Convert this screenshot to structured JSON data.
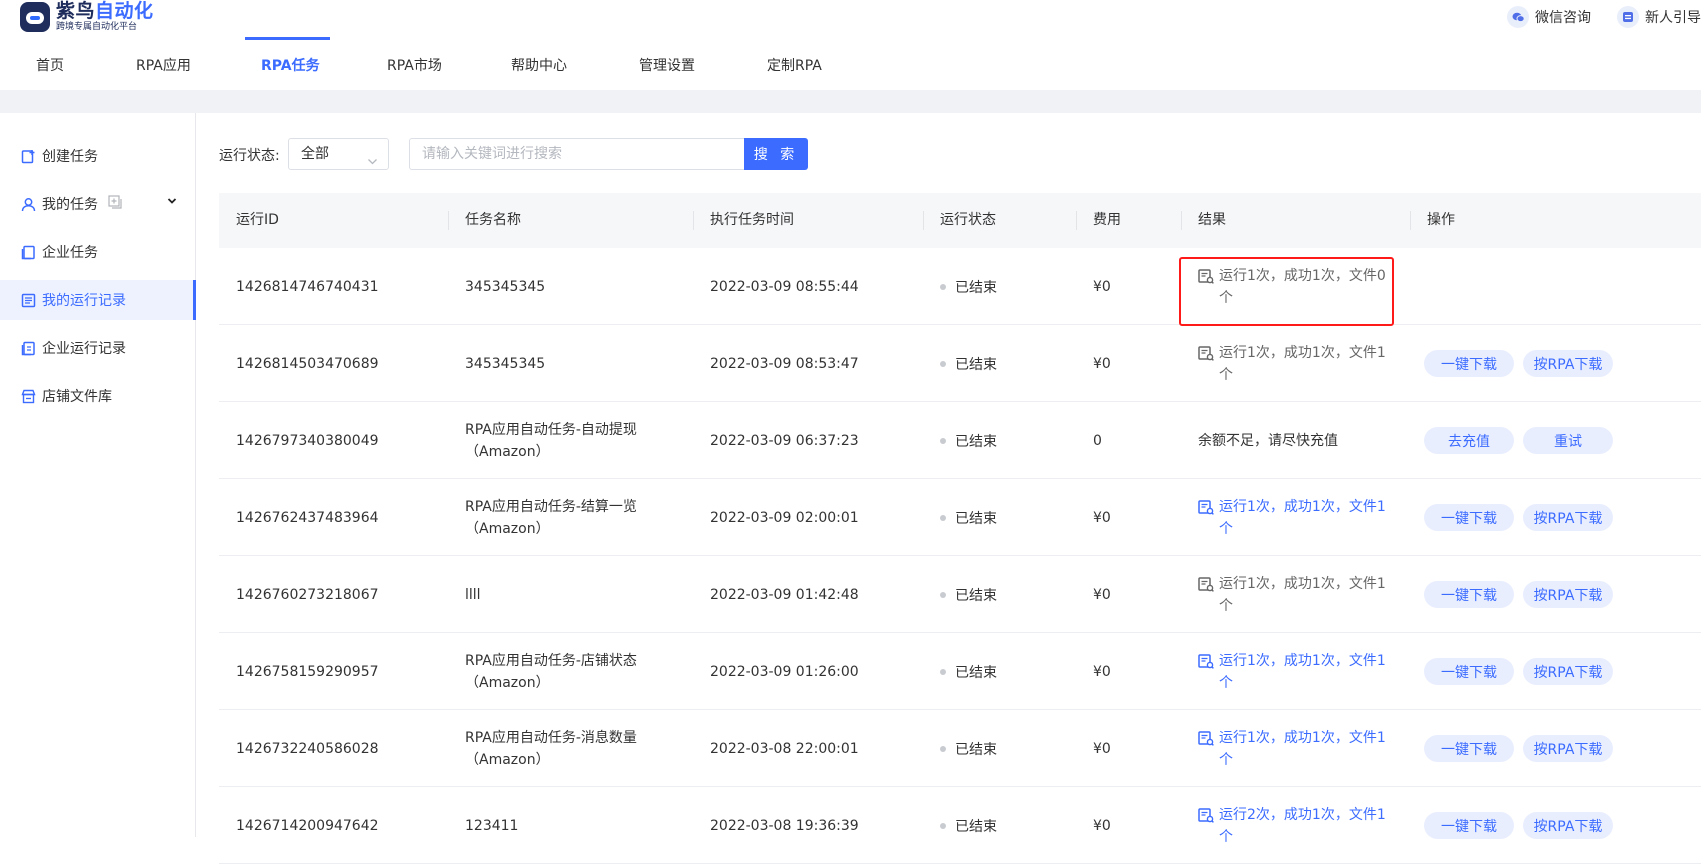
{
  "header": {
    "logo_title_main": "紫鸟",
    "logo_title_accent": "自动化",
    "logo_subtitle": "跨境专属自动化平台",
    "wechat_label": "微信咨询",
    "guide_label": "新人引导"
  },
  "nav": {
    "items": [
      {
        "label": "首页"
      },
      {
        "label": "RPA应用"
      },
      {
        "label": "RPA任务"
      },
      {
        "label": "RPA市场"
      },
      {
        "label": "帮助中心"
      },
      {
        "label": "管理设置"
      },
      {
        "label": "定制RPA"
      }
    ],
    "active": "RPA任务"
  },
  "sidebar": {
    "items": [
      {
        "label": "创建任务",
        "icon": "create-task-icon"
      },
      {
        "label": "我的任务",
        "icon": "user-icon"
      },
      {
        "label": "企业任务",
        "icon": "book-icon"
      },
      {
        "label": "我的运行记录",
        "icon": "list-icon"
      },
      {
        "label": "企业运行记录",
        "icon": "book-icon"
      },
      {
        "label": "店铺文件库",
        "icon": "store-icon"
      }
    ],
    "active": "我的运行记录"
  },
  "filters": {
    "status_label": "运行状态:",
    "status_value": "全部",
    "search_placeholder": "请输入关键词进行搜索",
    "search_button": "搜 索"
  },
  "table": {
    "columns": [
      "运行ID",
      "任务名称",
      "执行任务时间",
      "运行状态",
      "费用",
      "结果",
      "操作"
    ],
    "rows": [
      {
        "id": "1426814746740431",
        "name_1": "345345345",
        "name_2": "",
        "time": "2022-03-09 08:55:44",
        "status": "已结束",
        "fee": "¥0",
        "result_1": "运行1次，成功1次，文件0",
        "result_2": "个",
        "result_style": "gray",
        "actions": []
      },
      {
        "id": "1426814503470689",
        "name_1": "345345345",
        "name_2": "",
        "time": "2022-03-09 08:53:47",
        "status": "已结束",
        "fee": "¥0",
        "result_1": "运行1次，成功1次，文件1",
        "result_2": "个",
        "result_style": "gray",
        "actions": [
          "一键下载",
          "按RPA下载"
        ]
      },
      {
        "id": "1426797340380049",
        "name_1": "RPA应用自动任务-自动提现",
        "name_2": "（Amazon）",
        "time": "2022-03-09 06:37:23",
        "status": "已结束",
        "fee": "0",
        "result_1": "余额不足，请尽快充值",
        "result_2": "",
        "result_style": "plain",
        "actions": [
          "去充值",
          "重试"
        ]
      },
      {
        "id": "1426762437483964",
        "name_1": "RPA应用自动任务-结算一览",
        "name_2": "（Amazon）",
        "time": "2022-03-09 02:00:01",
        "status": "已结束",
        "fee": "¥0",
        "result_1": "运行1次，成功1次，文件1",
        "result_2": "个",
        "result_style": "blue",
        "actions": [
          "一键下载",
          "按RPA下载"
        ]
      },
      {
        "id": "1426760273218067",
        "name_1": "llll",
        "name_2": "",
        "time": "2022-03-09 01:42:48",
        "status": "已结束",
        "fee": "¥0",
        "result_1": "运行1次，成功1次，文件1",
        "result_2": "个",
        "result_style": "gray",
        "actions": [
          "一键下载",
          "按RPA下载"
        ]
      },
      {
        "id": "1426758159290957",
        "name_1": "RPA应用自动任务-店铺状态",
        "name_2": "（Amazon）",
        "time": "2022-03-09 01:26:00",
        "status": "已结束",
        "fee": "¥0",
        "result_1": "运行1次，成功1次，文件1",
        "result_2": "个",
        "result_style": "blue",
        "actions": [
          "一键下载",
          "按RPA下载"
        ]
      },
      {
        "id": "1426732240586028",
        "name_1": "RPA应用自动任务-消息数量",
        "name_2": "（Amazon）",
        "time": "2022-03-08 22:00:01",
        "status": "已结束",
        "fee": "¥0",
        "result_1": "运行1次，成功1次，文件1",
        "result_2": "个",
        "result_style": "blue",
        "actions": [
          "一键下载",
          "按RPA下载"
        ]
      },
      {
        "id": "1426714200947642",
        "name_1": "123411",
        "name_2": "",
        "time": "2022-03-08 19:36:39",
        "status": "已结束",
        "fee": "¥0",
        "result_1": "运行2次，成功1次，文件1",
        "result_2": "个",
        "result_style": "blue",
        "actions": [
          "一键下载",
          "按RPA下载"
        ]
      }
    ]
  },
  "colors": {
    "primary": "#3c6cff",
    "highlight_border": "#ff1a1a"
  }
}
